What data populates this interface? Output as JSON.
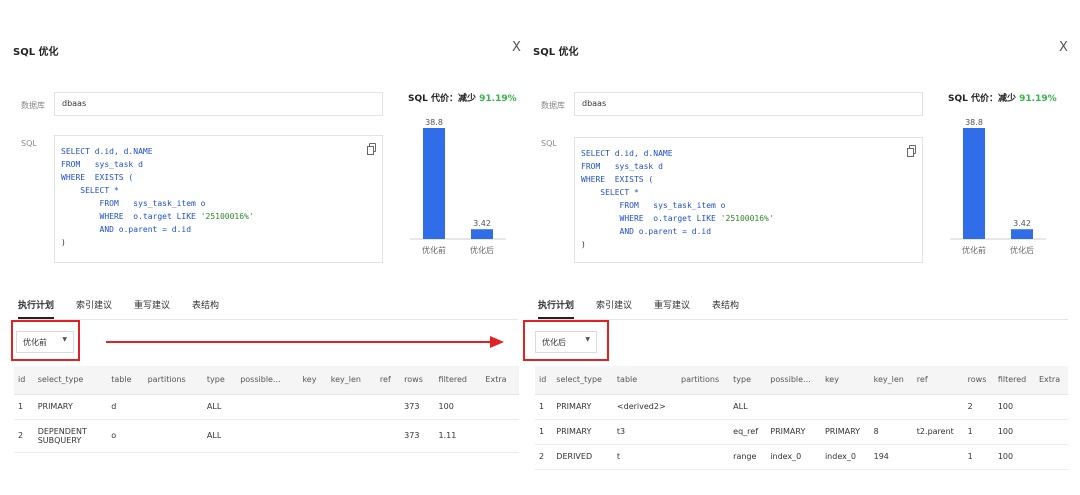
{
  "panels": [
    {
      "title": "SQL 优化",
      "close": "X",
      "db_label": "数据库",
      "db_value": "dbaas",
      "sql_label": "SQL",
      "sql_lines": [
        [
          {
            "t": "SELECT d.id, d.NAME",
            "k": "kw"
          }
        ],
        [
          {
            "t": "FROM   sys_task d",
            "k": "kw"
          }
        ],
        [
          {
            "t": "WHERE  EXISTS (",
            "k": "kw"
          }
        ],
        [
          {
            "t": "    SELECT *",
            "k": "kw"
          }
        ],
        [
          {
            "t": "        FROM   sys_task_item o",
            "k": "kw"
          }
        ],
        [
          {
            "t": "        WHERE  o.target LIKE ",
            "k": "kw"
          },
          {
            "t": "'25100016%'",
            "k": "str"
          }
        ],
        [
          {
            "t": "        AND o.parent = d.id",
            "k": "kw"
          }
        ],
        [
          {
            "t": ")",
            "k": ""
          }
        ]
      ],
      "cost_prefix": "SQL 代价：减少 ",
      "cost_pct": "91.19%",
      "chart_data": {
        "type": "bar",
        "categories": [
          "优化前",
          "优化后"
        ],
        "values": [
          38.8,
          3.42
        ],
        "value_labels": [
          "38.8",
          "3.42"
        ],
        "color": "#2f6ee8",
        "ylim": [
          0,
          38.8
        ]
      },
      "tabs": [
        "执行计划",
        "索引建议",
        "重写建议",
        "表结构"
      ],
      "active_tab": 0,
      "select_value": "优化前",
      "table": {
        "headers": [
          "id",
          "select_type",
          "table",
          "partitions",
          "type",
          "possible...",
          "key",
          "key_len",
          "ref",
          "rows",
          "filtered",
          "Extra"
        ],
        "rows": [
          [
            "1",
            "PRIMARY",
            "d",
            "",
            "ALL",
            "",
            "",
            "",
            "",
            "373",
            "100",
            ""
          ],
          [
            "2",
            "DEPENDENT\nSUBQUERY",
            "o",
            "",
            "ALL",
            "",
            "",
            "",
            "",
            "373",
            "1.11",
            ""
          ]
        ]
      }
    },
    {
      "title": "SQL 优化",
      "close": "X",
      "db_label": "数据库",
      "db_value": "dbaas",
      "sql_label": "SQL",
      "sql_lines": [
        [
          {
            "t": "SELECT d.id, d.NAME",
            "k": "kw"
          }
        ],
        [
          {
            "t": "FROM   sys_task d",
            "k": "kw"
          }
        ],
        [
          {
            "t": "WHERE  EXISTS (",
            "k": "kw"
          }
        ],
        [
          {
            "t": "    SELECT *",
            "k": "kw"
          }
        ],
        [
          {
            "t": "        FROM   sys_task_item o",
            "k": "kw"
          }
        ],
        [
          {
            "t": "        WHERE  o.target LIKE ",
            "k": "kw"
          },
          {
            "t": "'25100016%'",
            "k": "str"
          }
        ],
        [
          {
            "t": "        AND o.parent = d.id",
            "k": "kw"
          }
        ],
        [
          {
            "t": ")",
            "k": ""
          }
        ]
      ],
      "cost_prefix": "SQL 代价：减少 ",
      "cost_pct": "91.19%",
      "chart_data": {
        "type": "bar",
        "categories": [
          "优化前",
          "优化后"
        ],
        "values": [
          38.8,
          3.42
        ],
        "value_labels": [
          "38.8",
          "3.42"
        ],
        "color": "#2f6ee8",
        "ylim": [
          0,
          38.8
        ]
      },
      "tabs": [
        "执行计划",
        "索引建议",
        "重写建议",
        "表结构"
      ],
      "active_tab": 0,
      "select_value": "优化后",
      "table": {
        "headers": [
          "id",
          "select_type",
          "table",
          "partitions",
          "type",
          "possible...",
          "key",
          "key_len",
          "ref",
          "rows",
          "filtered",
          "Extra"
        ],
        "rows": [
          [
            "1",
            "PRIMARY",
            "<derived2>",
            "",
            "ALL",
            "",
            "",
            "",
            "",
            "2",
            "100",
            ""
          ],
          [
            "1",
            "PRIMARY",
            "t3",
            "",
            "eq_ref",
            "PRIMARY",
            "PRIMARY",
            "8",
            "t2.parent",
            "1",
            "100",
            ""
          ],
          [
            "2",
            "DERIVED",
            "t",
            "",
            "range",
            "index_0",
            "index_0",
            "194",
            "",
            "1",
            "100",
            ""
          ]
        ]
      }
    }
  ],
  "colors": {
    "accent_bar": "#2f6ee8",
    "highlight_box": "#e22222",
    "percent_green": "#35b44a"
  }
}
